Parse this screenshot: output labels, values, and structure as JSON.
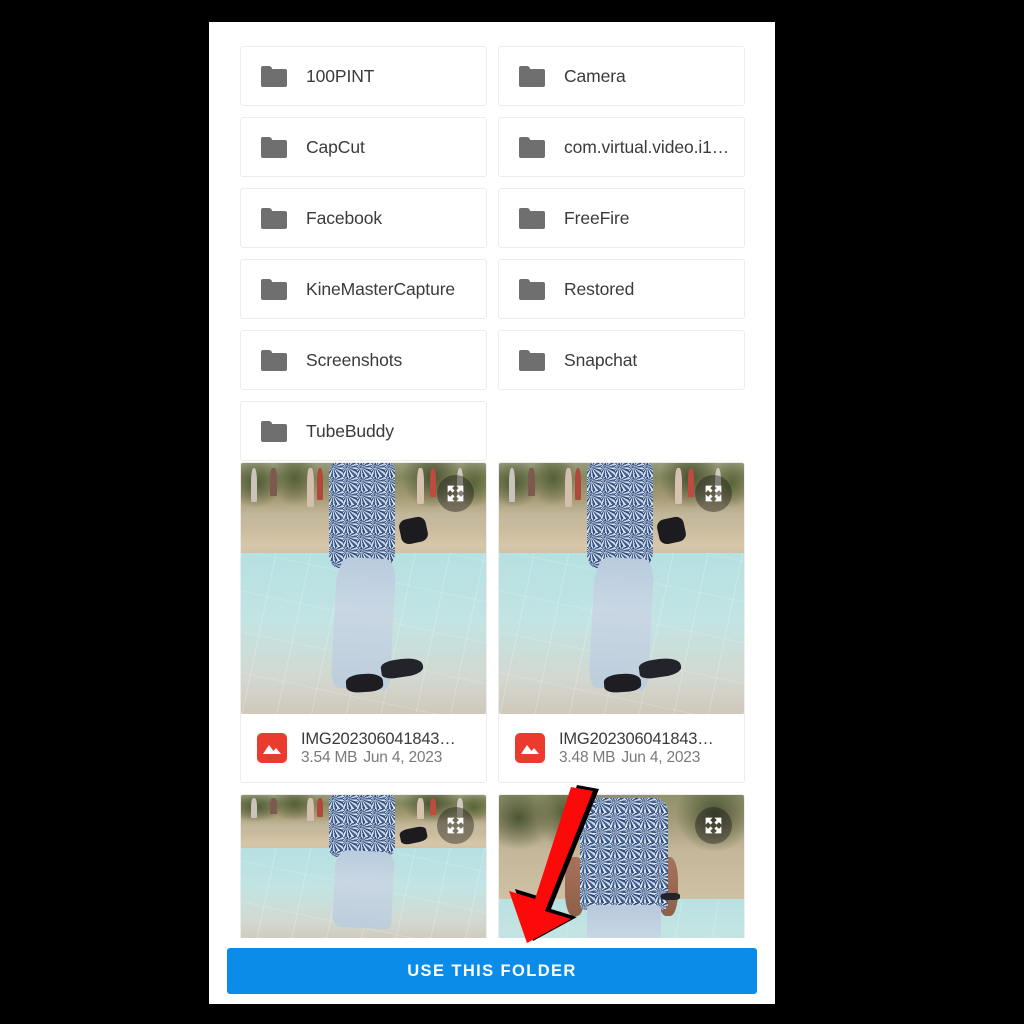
{
  "screen": {
    "background_color": "#000000",
    "panel_background": "#ffffff"
  },
  "folders": {
    "icon_name": "folder-icon",
    "icon_color": "#6f6f6f",
    "items": [
      {
        "label": "100PINT"
      },
      {
        "label": "Camera"
      },
      {
        "label": "CapCut"
      },
      {
        "label": "com.virtual.video.i1…"
      },
      {
        "label": "Facebook"
      },
      {
        "label": "FreeFire"
      },
      {
        "label": "KineMasterCapture"
      },
      {
        "label": "Restored"
      },
      {
        "label": "Screenshots"
      },
      {
        "label": "Snapchat"
      },
      {
        "label": "TubeBuddy"
      }
    ]
  },
  "files": {
    "type_icon_name": "image-file-icon",
    "type_icon_color": "#ea3b2e",
    "expand_icon_name": "expand-icon",
    "items": [
      {
        "name": "IMG202306041843…",
        "size": "3.54 MB",
        "date": "Jun 4, 2023",
        "photo": "person-walking-on-teal-tiled-floor"
      },
      {
        "name": "IMG202306041843…",
        "size": "3.48 MB",
        "date": "Jun 4, 2023",
        "photo": "person-walking-on-teal-tiled-floor"
      },
      {
        "photo": "person-walking-on-teal-tiled-floor"
      },
      {
        "photo": "person-standing-facing-camera"
      }
    ]
  },
  "annotation": {
    "name": "red-down-arrow",
    "fill_color": "#fb0a09",
    "outline_color": "#000000",
    "points_to": "use-this-folder-button"
  },
  "action_bar": {
    "use_folder_label": "USE THIS FOLDER",
    "button_color": "#0a8ce8",
    "button_text_color": "#ffffff"
  }
}
